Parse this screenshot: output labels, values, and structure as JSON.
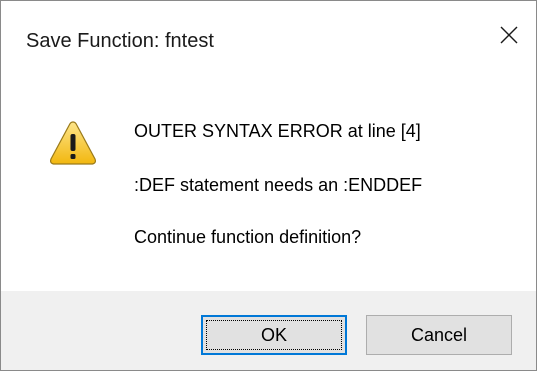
{
  "window": {
    "title": "Save Function: fntest",
    "close_glyph": "✕"
  },
  "icon": "warning-icon",
  "message": {
    "line1": "OUTER SYNTAX ERROR at line [4]",
    "line2": ":DEF statement needs an :ENDDEF",
    "line3": "Continue function definition?"
  },
  "buttons": {
    "ok_label": "OK",
    "cancel_label": "Cancel"
  },
  "colors": {
    "accent": "#0078d7",
    "footer_bg": "#f0f0f0",
    "warning_fill": "#f7c21b"
  }
}
